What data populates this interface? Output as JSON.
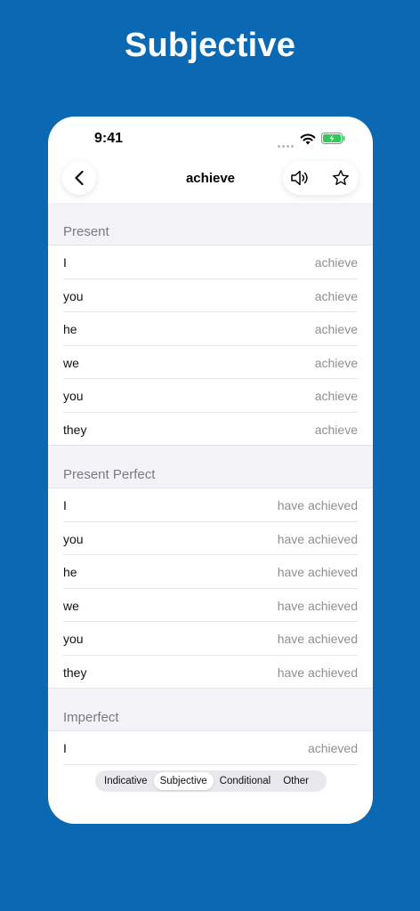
{
  "hero": {
    "title": "Subjective"
  },
  "status_bar": {
    "time": "9:41"
  },
  "nav": {
    "title": "achieve",
    "back_icon": "chevron-left-icon",
    "speaker_icon": "speaker-icon",
    "star_icon": "star-icon"
  },
  "sections": [
    {
      "title": "Present",
      "rows": [
        {
          "pronoun": "I",
          "form": "achieve"
        },
        {
          "pronoun": "you",
          "form": "achieve"
        },
        {
          "pronoun": "he",
          "form": "achieve"
        },
        {
          "pronoun": "we",
          "form": "achieve"
        },
        {
          "pronoun": "you",
          "form": "achieve"
        },
        {
          "pronoun": "they",
          "form": "achieve"
        }
      ]
    },
    {
      "title": "Present Perfect",
      "rows": [
        {
          "pronoun": "I",
          "form": "have achieved"
        },
        {
          "pronoun": "you",
          "form": "have achieved"
        },
        {
          "pronoun": "he",
          "form": "have achieved"
        },
        {
          "pronoun": "we",
          "form": "have achieved"
        },
        {
          "pronoun": "you",
          "form": "have achieved"
        },
        {
          "pronoun": "they",
          "form": "have achieved"
        }
      ]
    },
    {
      "title": "Imperfect",
      "rows": [
        {
          "pronoun": "I",
          "form": "achieved"
        }
      ]
    }
  ],
  "mood_tabs": {
    "items": [
      "Indicative",
      "Subjective",
      "Conditional",
      "Other"
    ],
    "selected": "Subjective"
  },
  "colors": {
    "background": "#0b68b3",
    "card": "#ffffff",
    "section_bg": "#f2f2f7",
    "battery": "#34c759"
  }
}
